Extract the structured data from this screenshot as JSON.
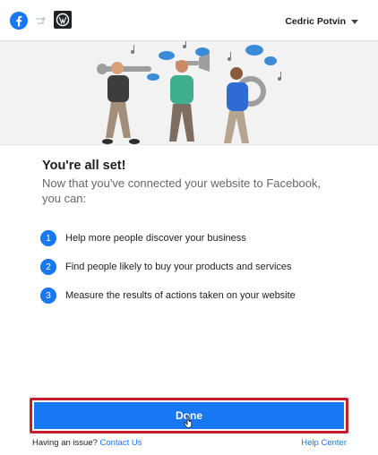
{
  "header": {
    "account_name": "Cedric Potvin",
    "icons": [
      "facebook-logo-icon",
      "link-icon",
      "wordpress-logo-icon",
      "caret-down-icon"
    ]
  },
  "hero": {
    "illustration": "three-musicians-illustration"
  },
  "main": {
    "title": "You're all set!",
    "subtitle": "Now that you've connected your website to Facebook, you can:",
    "steps": [
      {
        "number": "1",
        "text": "Help more people discover your business"
      },
      {
        "number": "2",
        "text": "Find people likely to buy your products and services"
      },
      {
        "number": "3",
        "text": "Measure the results of actions taken on your website"
      }
    ]
  },
  "actions": {
    "done_label": "Done"
  },
  "footer": {
    "issue_text": "Having an issue?",
    "contact_link": "Contact Us",
    "help_center": "Help Center"
  },
  "colors": {
    "accent": "#1877f2",
    "highlight": "#c3202b",
    "hero_bg": "#f2f2f2"
  }
}
